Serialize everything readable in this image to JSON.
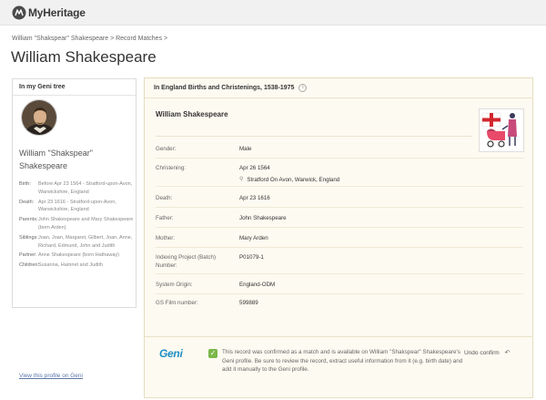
{
  "header": {
    "logo_text": "MyHeritage",
    "logo_icon": "myheritage-logo-icon"
  },
  "breadcrumb": "William \"Shakspear\" Shakespeare > Record Matches >",
  "page_title": "William Shakespeare",
  "geni_card": {
    "title": "In my Geni tree",
    "name": "William \"Shakspear\" Shakespeare",
    "facts": [
      {
        "label": "Birth:",
        "value": "Before Apr 23 1564 - Stratford-upon-Avon, Warwickshire, England"
      },
      {
        "label": "Death:",
        "value": "Apr 23 1616 - Stratford-upon-Avon, Warwickshire, England"
      },
      {
        "label": "Parents:",
        "value": "John Shakespeare and Mary Shakespeare (born Arden)"
      },
      {
        "label": "Siblings:",
        "value": "Joan, Joan, Margaret, Gilbert, Joan, Anne, Richard, Edmund, John and Judith"
      },
      {
        "label": "Partner:",
        "value": "Anne Shakespeare (born Hathaway)"
      },
      {
        "label": "Children:",
        "value": "Susanna, Hamnet and Judith"
      }
    ],
    "view_profile_link": "View this profile on Geni"
  },
  "record": {
    "collection": "In England Births and Christenings, 1538-1975",
    "info_icon": "info-icon",
    "name": "William Shakespeare",
    "rows": [
      {
        "label": "Gender:",
        "value": "Male"
      },
      {
        "label": "Christening:",
        "value": "Apr 26 1564",
        "place": "Stratford On Avon, Warwick, England"
      },
      {
        "label": "Death:",
        "value": "Apr 23 1616"
      },
      {
        "label": "Father:",
        "value": "John Shakespeare"
      },
      {
        "label": "Mother:",
        "value": "Mary Arden"
      },
      {
        "label": "Indexing Project (Batch) Number:",
        "value": "P01079-1"
      },
      {
        "label": "System Origin:",
        "value": "England-ODM"
      },
      {
        "label": "GS Film number:",
        "value": "599889"
      }
    ]
  },
  "geni_match": {
    "logo": "Geni",
    "message": "This record was confirmed as a match and is available on William \"Shakspear\" Shakespeare's Geni profile. Be sure to review the record, extract useful information from it (e.g. birth date) and add it manually to the Geni profile.",
    "undo_label": "Undo confirm"
  },
  "colors": {
    "geni_blue": "#1e8fc6",
    "confirm_green": "#7bb84a",
    "link_blue": "#5b77a8",
    "record_bg": "#fdfaf1"
  }
}
